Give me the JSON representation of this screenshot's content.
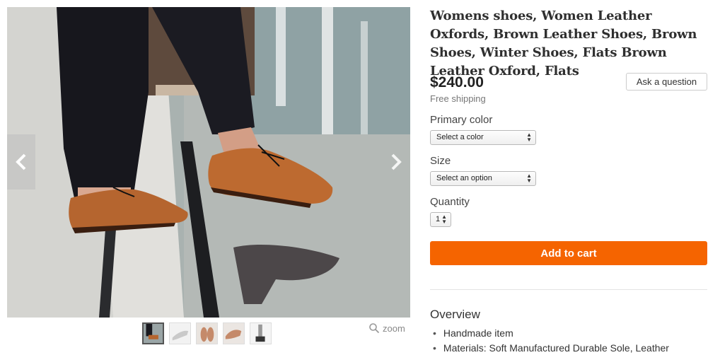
{
  "product": {
    "title": "Womens shoes, Women Leather Oxfords, Brown Leather Shoes, Brown Shoes, Winter Shoes, Flats Brown Leather Oxford, Flats",
    "price": "$240.00",
    "shipping": "Free shipping",
    "ask_button": "Ask a question"
  },
  "options": {
    "color": {
      "label": "Primary color",
      "selected": "Select a color"
    },
    "size": {
      "label": "Size",
      "selected": "Select an option"
    },
    "quantity": {
      "label": "Quantity",
      "selected": "1"
    }
  },
  "cart": {
    "label": "Add to cart"
  },
  "overview": {
    "heading": "Overview",
    "items": [
      "Handmade item",
      "Materials: Soft Manufactured Durable Sole, Leather"
    ]
  },
  "gallery": {
    "zoom_label": "zoom",
    "thumbnail_count": 5,
    "active_thumbnail": 1
  },
  "colors": {
    "accent": "#f56400",
    "shoe": "#b5652f",
    "trousers": "#16161e"
  }
}
